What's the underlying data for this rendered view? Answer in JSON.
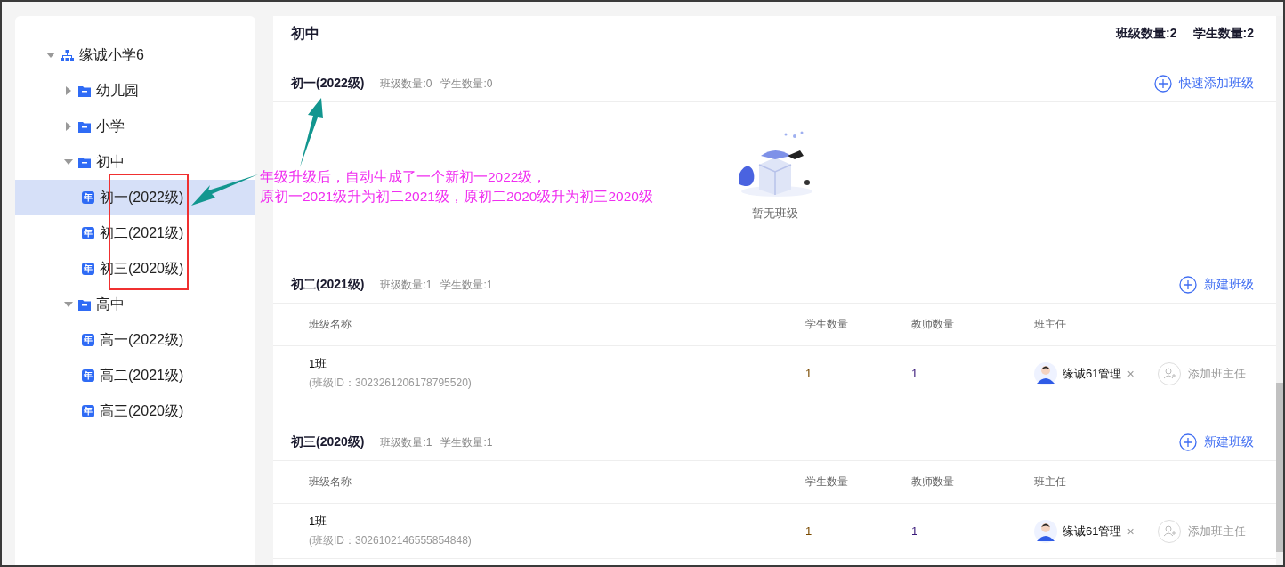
{
  "sidebar": {
    "tree": [
      {
        "label": "缘诚小学6",
        "kind": "school",
        "expanded": true,
        "selected": false,
        "children": [
          {
            "label": "幼儿园",
            "kind": "stage",
            "expanded": false,
            "selected": false
          },
          {
            "label": "小学",
            "kind": "stage",
            "expanded": false,
            "selected": false
          },
          {
            "label": "初中",
            "kind": "stage",
            "expanded": true,
            "selected": false,
            "children": [
              {
                "label": "初一(2022级)",
                "kind": "grade",
                "badge": "年",
                "selected": true
              },
              {
                "label": "初二(2021级)",
                "kind": "grade",
                "badge": "年",
                "selected": false
              },
              {
                "label": "初三(2020级)",
                "kind": "grade",
                "badge": "年",
                "selected": false
              }
            ]
          },
          {
            "label": "高中",
            "kind": "stage",
            "expanded": true,
            "selected": false,
            "children": [
              {
                "label": "高一(2022级)",
                "kind": "grade",
                "badge": "年",
                "selected": false
              },
              {
                "label": "高二(2021级)",
                "kind": "grade",
                "badge": "年",
                "selected": false
              },
              {
                "label": "高三(2020级)",
                "kind": "grade",
                "badge": "年",
                "selected": false
              }
            ]
          }
        ]
      }
    ]
  },
  "main": {
    "title": "初中",
    "class_count": "班级数量:2",
    "student_count": "学生数量:2",
    "grades": [
      {
        "kind": "empty",
        "title": "初一(2022级)",
        "class_count": "班级数量:0",
        "student_count": "学生数量:0",
        "action": "快速添加班级",
        "empty_text": "暂无班级"
      },
      {
        "kind": "table",
        "title": "初二(2021级)",
        "class_count": "班级数量:1",
        "student_count": "学生数量:1",
        "action": "新建班级",
        "columns": [
          "班级名称",
          "学生数量",
          "教师数量",
          "班主任"
        ],
        "rows": [
          {
            "name": "1班",
            "class_id": "(班级ID：3023261206178795520)",
            "students": "1",
            "teachers": "1",
            "head_teacher": "缘诚61管理",
            "remove": "×",
            "add_label": "添加班主任"
          }
        ]
      },
      {
        "kind": "table",
        "title": "初三(2020级)",
        "class_count": "班级数量:1",
        "student_count": "学生数量:1",
        "action": "新建班级",
        "columns": [
          "班级名称",
          "学生数量",
          "教师数量",
          "班主任"
        ],
        "rows": [
          {
            "name": "1班",
            "class_id": "(班级ID：3026102146555854848)",
            "students": "1",
            "teachers": "1",
            "head_teacher": "缘诚61管理",
            "remove": "×",
            "add_label": "添加班主任"
          }
        ]
      }
    ]
  },
  "annotation": {
    "lines": [
      "年级升级后，自动生成了一个新初一2022级，",
      "原初一2021级升为初二2021级，原初二2020级升为初三2020级"
    ]
  }
}
